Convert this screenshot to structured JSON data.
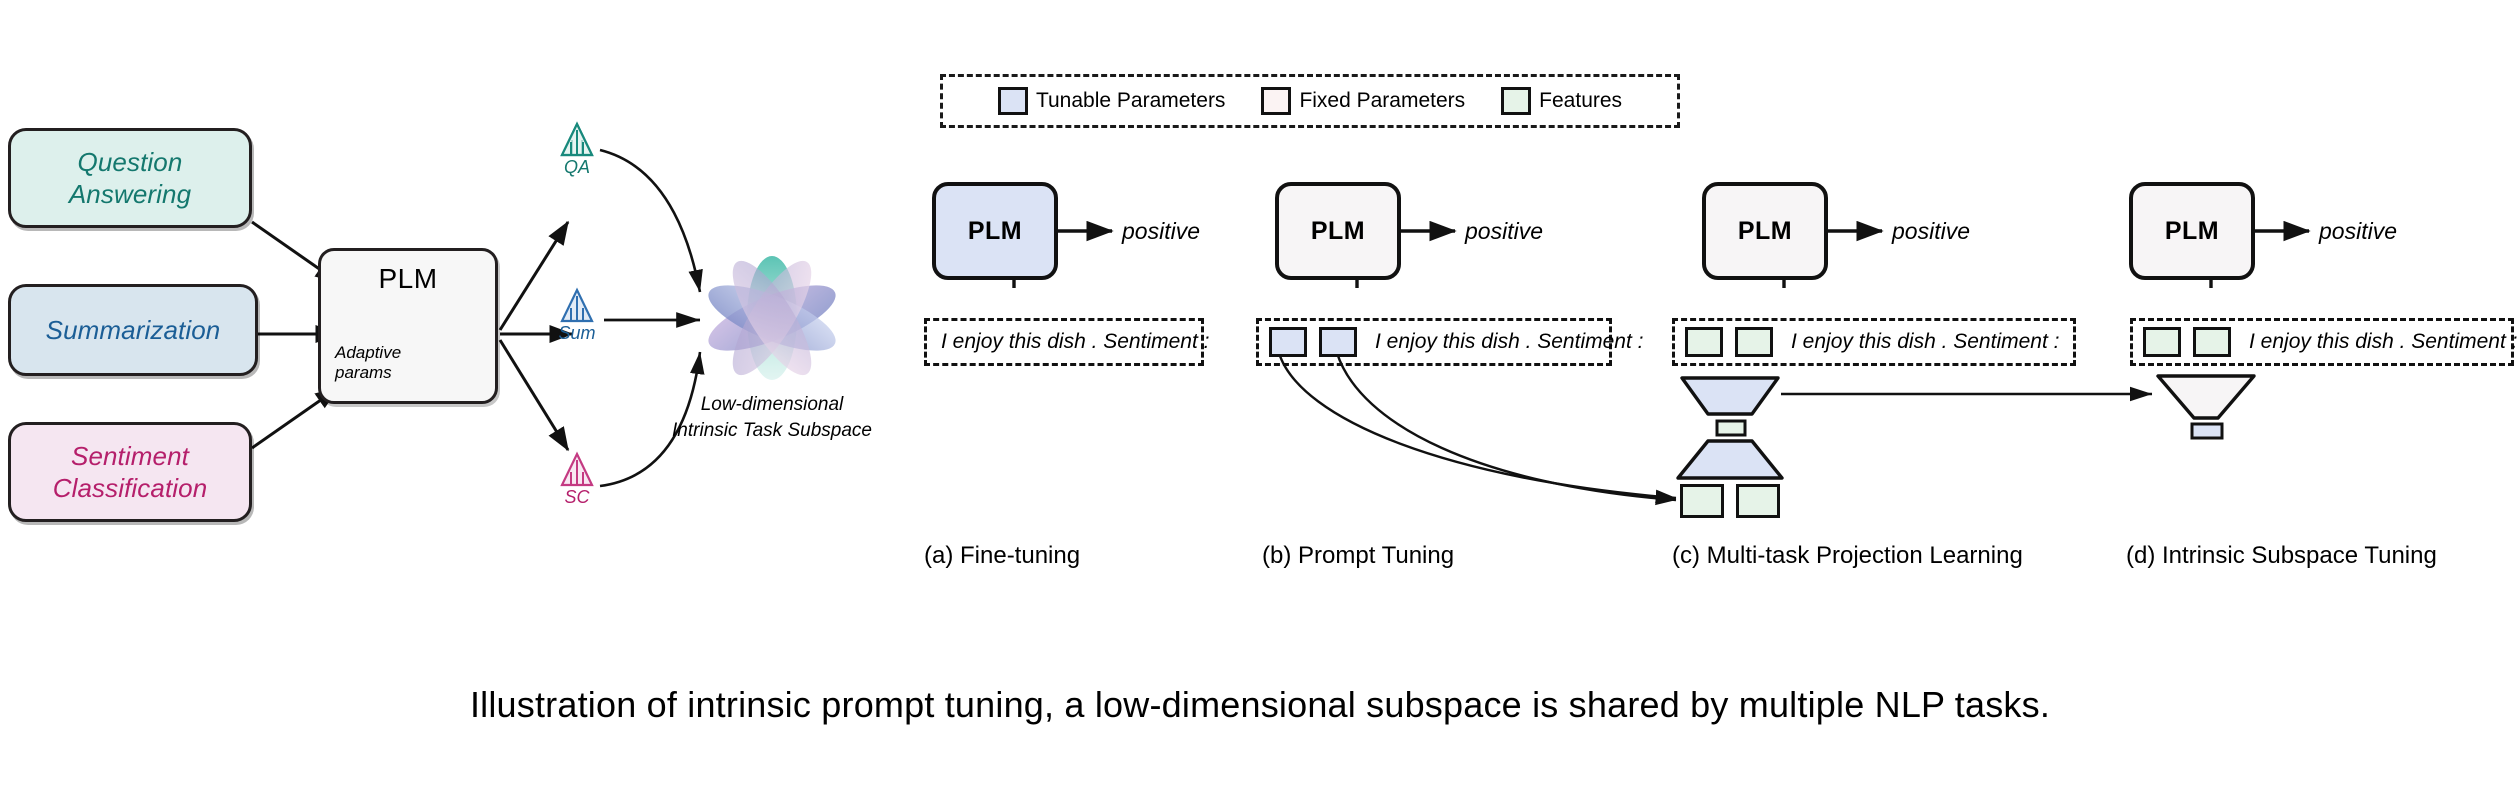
{
  "left_diagram": {
    "tasks": [
      {
        "label": "Question\nAnswering",
        "label_line1": "Question",
        "label_line2": "Answering",
        "color": "#14786e",
        "fill": "#ddf0ec"
      },
      {
        "label": "Summarization",
        "label_line1": "Summarization",
        "label_line2": "",
        "color": "#1b5e96",
        "fill": "#d8e5ee"
      },
      {
        "label": "Sentiment\nClassification",
        "label_line1": "Sentiment",
        "label_line2": "Classification",
        "color": "#b51f6b",
        "fill": "#f5e6f1"
      }
    ],
    "plm": {
      "title": "PLM",
      "adaptive_line1": "Adaptive",
      "adaptive_line2": "params"
    },
    "prompt_labels": [
      {
        "name": "QA",
        "color": "#14786e"
      },
      {
        "name": "Sum",
        "color": "#1b5e96"
      },
      {
        "name": "SC",
        "color": "#b51f6b"
      }
    ],
    "subspace": {
      "caption_line1": "Low-dimensional",
      "caption_line2": "Intrinsic Task Subspace"
    }
  },
  "legend": {
    "items": [
      {
        "label": "Tunable Parameters",
        "color": "#dbe3f5"
      },
      {
        "label": "Fixed Parameters",
        "color": "#fbf3f3"
      },
      {
        "label": "Features",
        "color": "#e6f3e8"
      }
    ]
  },
  "panels": [
    {
      "id": "a",
      "caption": "(a) Fine-tuning",
      "plm_label": "PLM",
      "plm_state": "tunable",
      "output_label": "positive",
      "input_text": "I enjoy this dish . Sentiment :",
      "tokens": []
    },
    {
      "id": "b",
      "caption": "(b) Prompt Tuning",
      "plm_label": "PLM",
      "plm_state": "fixed",
      "output_label": "positive",
      "input_text": "I enjoy this dish . Sentiment :",
      "tokens": [
        "tunable",
        "tunable"
      ]
    },
    {
      "id": "c",
      "caption": "(c) Multi-task Projection Learning",
      "plm_label": "PLM",
      "plm_state": "fixed",
      "output_label": "positive",
      "input_text": "I enjoy this dish . Sentiment :",
      "tokens": [
        "feature",
        "feature"
      ],
      "bottom_tokens": [
        "feature",
        "feature"
      ],
      "bottleneck": "feature"
    },
    {
      "id": "d",
      "caption": "(d) Intrinsic Subspace Tuning",
      "plm_label": "PLM",
      "plm_state": "fixed",
      "output_label": "positive",
      "input_text": "I enjoy this dish . Sentiment :",
      "tokens": [
        "feature",
        "feature"
      ],
      "bottleneck": "tunable"
    }
  ],
  "figure_caption": "Illustration of intrinsic prompt tuning, a low-dimensional subspace is shared by multiple NLP tasks."
}
